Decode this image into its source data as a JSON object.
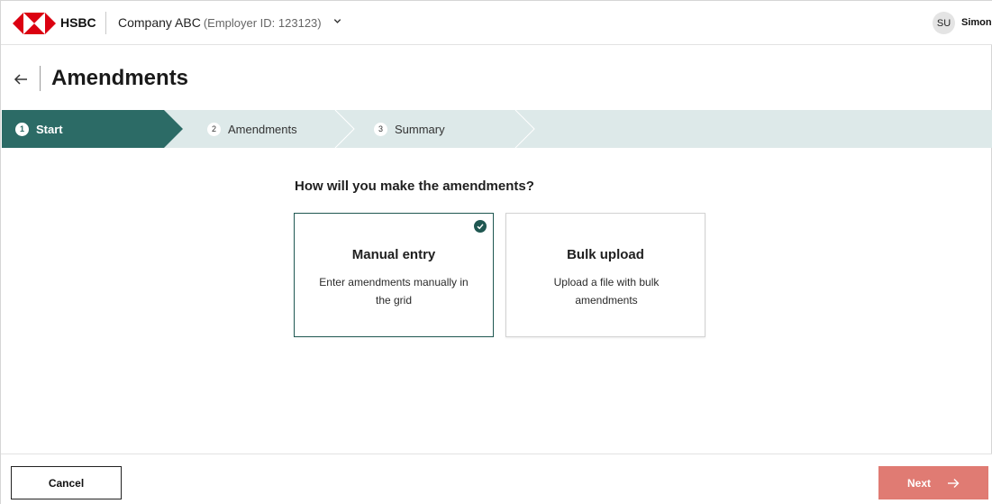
{
  "header": {
    "brand": "HSBC",
    "company_name": "Company ABC",
    "employer_id": "(Employer ID: 123123)",
    "user_initials": "SU",
    "user_name": "Simon"
  },
  "page": {
    "title": "Amendments"
  },
  "stepper": {
    "steps": [
      {
        "number": "1",
        "label": "Start",
        "state": "active"
      },
      {
        "number": "2",
        "label": "Amendments",
        "state": "inactive"
      },
      {
        "number": "3",
        "label": "Summary",
        "state": "inactive"
      }
    ]
  },
  "main": {
    "question": "How will you make the amendments?",
    "options": [
      {
        "title": "Manual entry",
        "description": "Enter amendments manually in the grid",
        "selected": true
      },
      {
        "title": "Bulk upload",
        "description": "Upload a file with bulk amendments",
        "selected": false
      }
    ]
  },
  "footer": {
    "cancel_label": "Cancel",
    "next_label": "Next"
  },
  "colors": {
    "brand_red": "#db0011",
    "step_active": "#2c6b66",
    "step_track": "#dde9e9",
    "selected_border": "#1f5751",
    "next_button": "#e07b73"
  },
  "icons": [
    "hsbc-logo",
    "chevron-down-icon",
    "back-arrow-icon",
    "check-circle-icon",
    "arrow-right-icon"
  ]
}
